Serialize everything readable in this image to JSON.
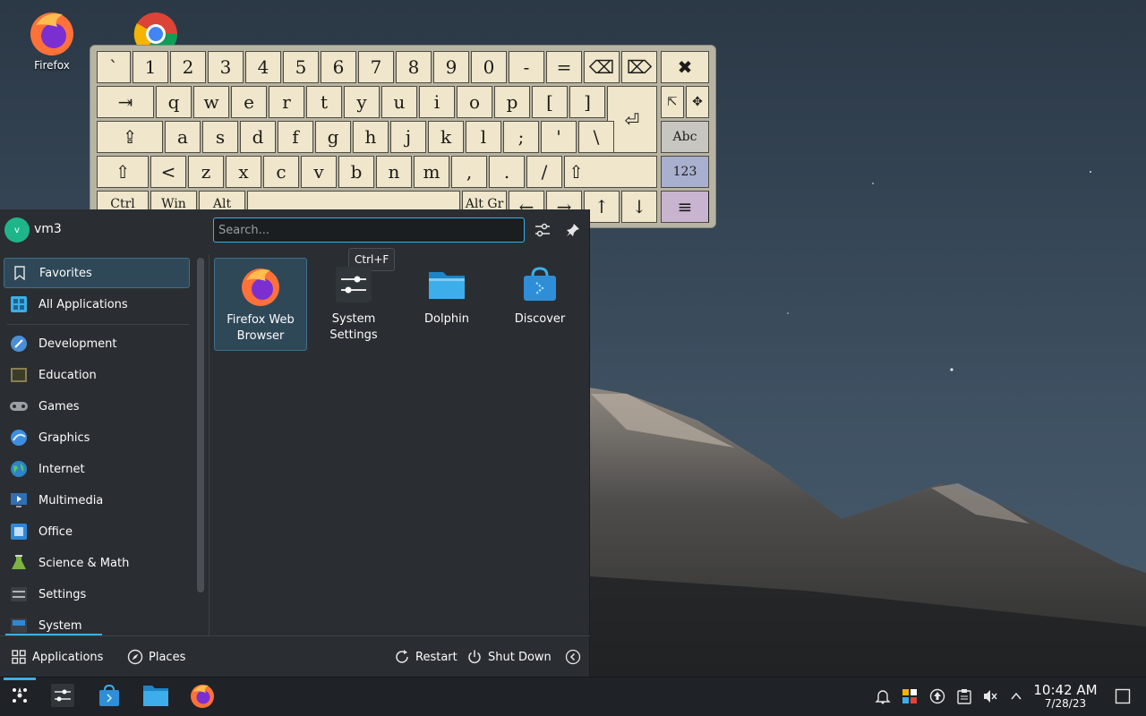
{
  "desktop": {
    "icons": [
      {
        "label": "Firefox"
      }
    ]
  },
  "keyboard": {
    "row1": [
      "`",
      "1",
      "2",
      "3",
      "4",
      "5",
      "6",
      "7",
      "8",
      "9",
      "0",
      "-",
      "=",
      "⌫",
      "⌦",
      "✖"
    ],
    "row2": [
      "⇥",
      "q",
      "w",
      "e",
      "r",
      "t",
      "y",
      "u",
      "i",
      "o",
      "p",
      "[",
      "]",
      "⏎"
    ],
    "row3": [
      "⇪",
      "a",
      "s",
      "d",
      "f",
      "g",
      "h",
      "j",
      "k",
      "l",
      ";",
      "'",
      "\\"
    ],
    "row4": [
      "⇧",
      "<",
      "z",
      "x",
      "c",
      "v",
      "b",
      "n",
      "m",
      ",",
      ".",
      "/",
      "⇧"
    ],
    "row5": [
      "Ctrl",
      "Win",
      "Alt",
      "",
      "Alt Gr",
      "←",
      "→",
      "↑",
      "↓"
    ],
    "side": {
      "pointer": "⇱",
      "move": "✥",
      "abc": "Abc",
      "num": "123",
      "menu": "≡"
    }
  },
  "menu": {
    "user": {
      "initial": "v",
      "name": "vm3"
    },
    "search": {
      "placeholder": "Search...",
      "shortcut_tooltip": "Ctrl+F"
    },
    "categories": [
      {
        "label": "Favorites"
      },
      {
        "label": "All Applications"
      },
      {
        "label": "Development"
      },
      {
        "label": "Education"
      },
      {
        "label": "Games"
      },
      {
        "label": "Graphics"
      },
      {
        "label": "Internet"
      },
      {
        "label": "Multimedia"
      },
      {
        "label": "Office"
      },
      {
        "label": "Science & Math"
      },
      {
        "label": "Settings"
      },
      {
        "label": "System"
      }
    ],
    "favorites": [
      {
        "label": "Firefox Web Browser"
      },
      {
        "label": "System Settings"
      },
      {
        "label": "Dolphin"
      },
      {
        "label": "Discover"
      }
    ],
    "footer": {
      "applications": "Applications",
      "places": "Places",
      "restart": "Restart",
      "shutdown": "Shut Down"
    }
  },
  "taskbar": {
    "clock": {
      "time": "10:42 AM",
      "date": "7/28/23"
    }
  },
  "colors": {
    "accent": "#3daee9",
    "panel": "#2a2e32",
    "taskbar": "#1f2226",
    "key": "#efe6cb"
  }
}
